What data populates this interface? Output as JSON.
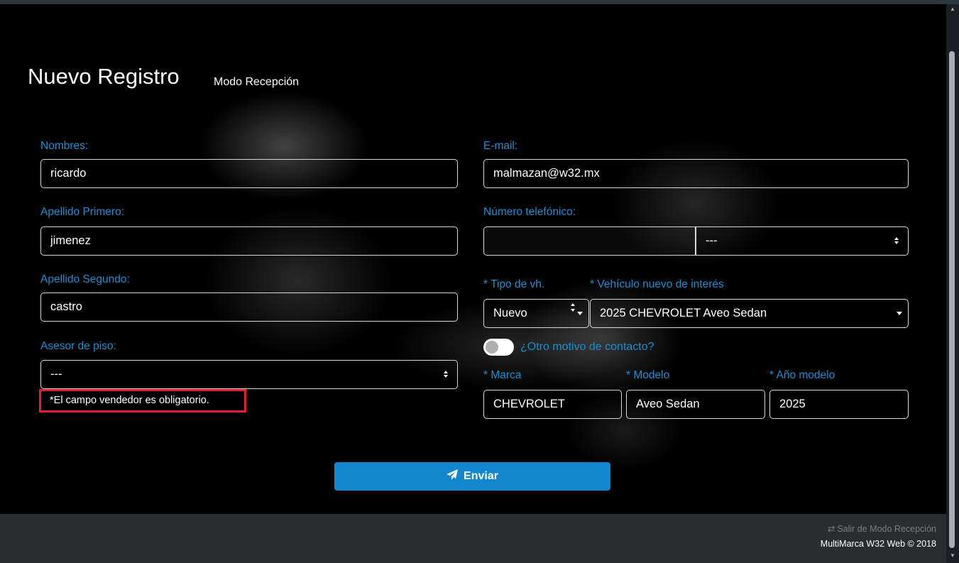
{
  "header": {
    "title": "Nuevo Registro",
    "subtitle": "Modo Recepción"
  },
  "form": {
    "nombres": {
      "label": "Nombres:",
      "value": "ricardo"
    },
    "apellido1": {
      "label": "Apellido Primero:",
      "value": "jimenez"
    },
    "apellido2": {
      "label": "Apellido Segundo:",
      "value": "castro"
    },
    "asesor": {
      "label": "Asesor de piso:",
      "value": "---"
    },
    "error_msg": "*El campo vendedor es obligatorio.",
    "email": {
      "label": "E-mail:",
      "value": "malmazan@w32.mx"
    },
    "telefono": {
      "label": "Número telefónico:",
      "value": "",
      "type_value": "---"
    },
    "tipo_vh": {
      "star": "*",
      "label": "Tipo de vh.",
      "value": "Nuevo"
    },
    "vehiculo": {
      "star": "*",
      "label": "Vehículo nuevo de interés",
      "value": "2025 CHEVROLET Aveo Sedan"
    },
    "otro_motivo": {
      "label": "¿Otro motivo de contacto?",
      "checked": false
    },
    "marca": {
      "star": "*",
      "label": "Marca",
      "value": "CHEVROLET"
    },
    "modelo": {
      "star": "*",
      "label": "Modelo",
      "value": "Aveo Sedan"
    },
    "anio": {
      "star": "*",
      "label": "Año modelo",
      "value": "2025"
    },
    "submit_label": "Enviar"
  },
  "footer": {
    "exit_label": "Salir de Modo Recepción",
    "copyright": "MultiMarca W32 Web © 2018"
  },
  "icons": {
    "submit": "paper-plane-icon",
    "exit": "exchange-arrows-icon",
    "select": "sort-caret-icon",
    "dropdown": "caret-down-icon"
  },
  "colors": {
    "accent": "#1a8fd4",
    "button": "#1287cf",
    "error_border": "#e0202a",
    "footer_bg": "#2b2c2f"
  }
}
